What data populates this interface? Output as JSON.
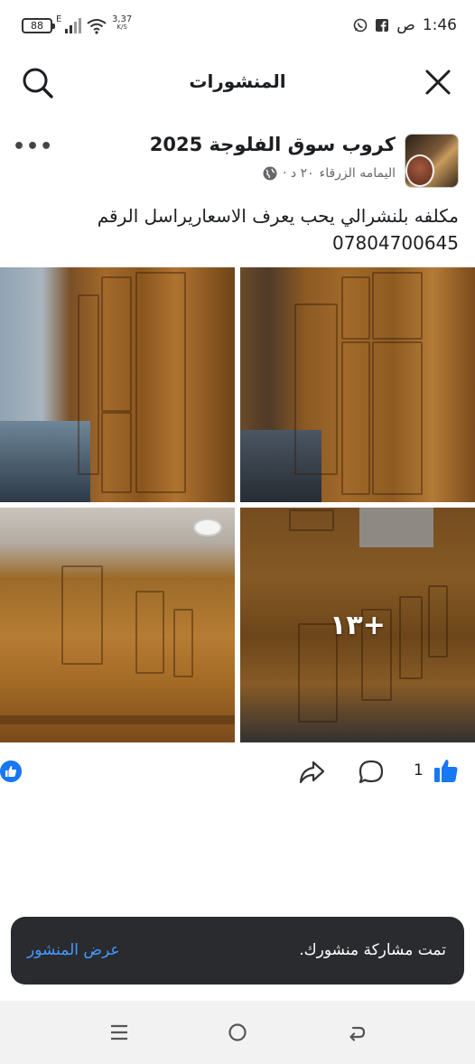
{
  "status_bar": {
    "battery": "88",
    "network_type": "E",
    "speed_value": "3,37",
    "speed_unit": "K/S",
    "time": "1:46",
    "ampm": "ص"
  },
  "header": {
    "title": "المنشورات"
  },
  "post": {
    "group_name": "كروب سوق الفلوجة 2025",
    "author": "اليمامه الزرقاء",
    "time_ago": "٢٠ د ·",
    "text_line1": "مكلفه بلنشرالي يحب يعرف الاسعاريراسل الرقم",
    "text_line2": "07804700645",
    "more_photos": "+١٣",
    "like_count": "1"
  },
  "toast": {
    "message": "تمت مشاركة منشورك.",
    "action": "عرض المنشور"
  },
  "colors": {
    "accent": "#1877f2",
    "toast_bg": "#2a2b2e",
    "toast_link": "#4599ff"
  }
}
